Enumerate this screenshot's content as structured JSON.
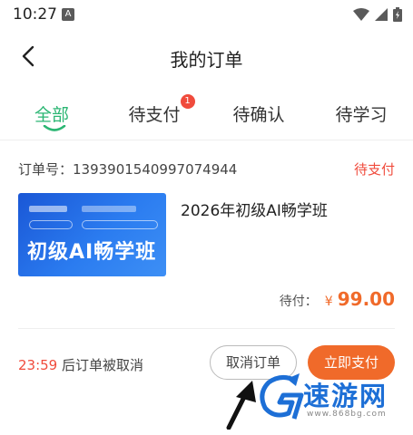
{
  "status_bar": {
    "time": "10:27",
    "notification_letter": "A"
  },
  "header": {
    "title": "我的订单"
  },
  "tabs": [
    {
      "label": "全部",
      "active": true
    },
    {
      "label": "待支付",
      "badge": "1"
    },
    {
      "label": "待确认"
    },
    {
      "label": "待学习"
    }
  ],
  "order": {
    "number_label": "订单号：1393901540997074944",
    "status": "待支付",
    "thumbnail_title": "初级AI畅学班",
    "course_title": "2026年初级AI畅学班",
    "price_label": "待付：",
    "currency": "¥",
    "price": "99.00",
    "countdown_time": "23:59",
    "countdown_text": " 后订单被取消",
    "cancel_label": "取消订单",
    "pay_label": "立即支付"
  },
  "watermark": {
    "text": "速游网",
    "url": "www.868bg.com"
  },
  "colors": {
    "accent_green": "#2bb673",
    "status_red": "#f04b3c",
    "pay_orange": "#f06a2a",
    "watermark_blue": "#1d6fd6"
  }
}
